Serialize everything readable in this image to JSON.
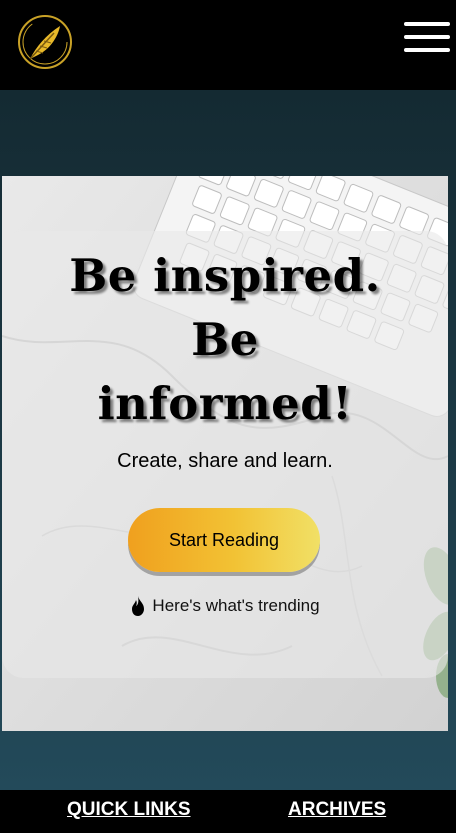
{
  "header": {
    "logo_icon": "feather-logo-icon",
    "menu_icon": "hamburger-menu-icon"
  },
  "hero": {
    "headline_line1": "Be inspired.",
    "headline_line2": "Be",
    "headline_line3": "informed!",
    "subtitle": "Create, share and learn.",
    "cta_label": "Start Reading",
    "trending_icon": "flame-icon",
    "trending_label": "Here's what's trending"
  },
  "footer": {
    "quick_links_label": "QUICK LINKS",
    "archives_label": "ARCHIVES"
  },
  "colors": {
    "topbar": "#000000",
    "page_bg": "#1d3a47",
    "cta_gradient_start": "#f0a01e",
    "cta_gradient_end": "#f1e066",
    "logo_gold": "#d4a017"
  }
}
